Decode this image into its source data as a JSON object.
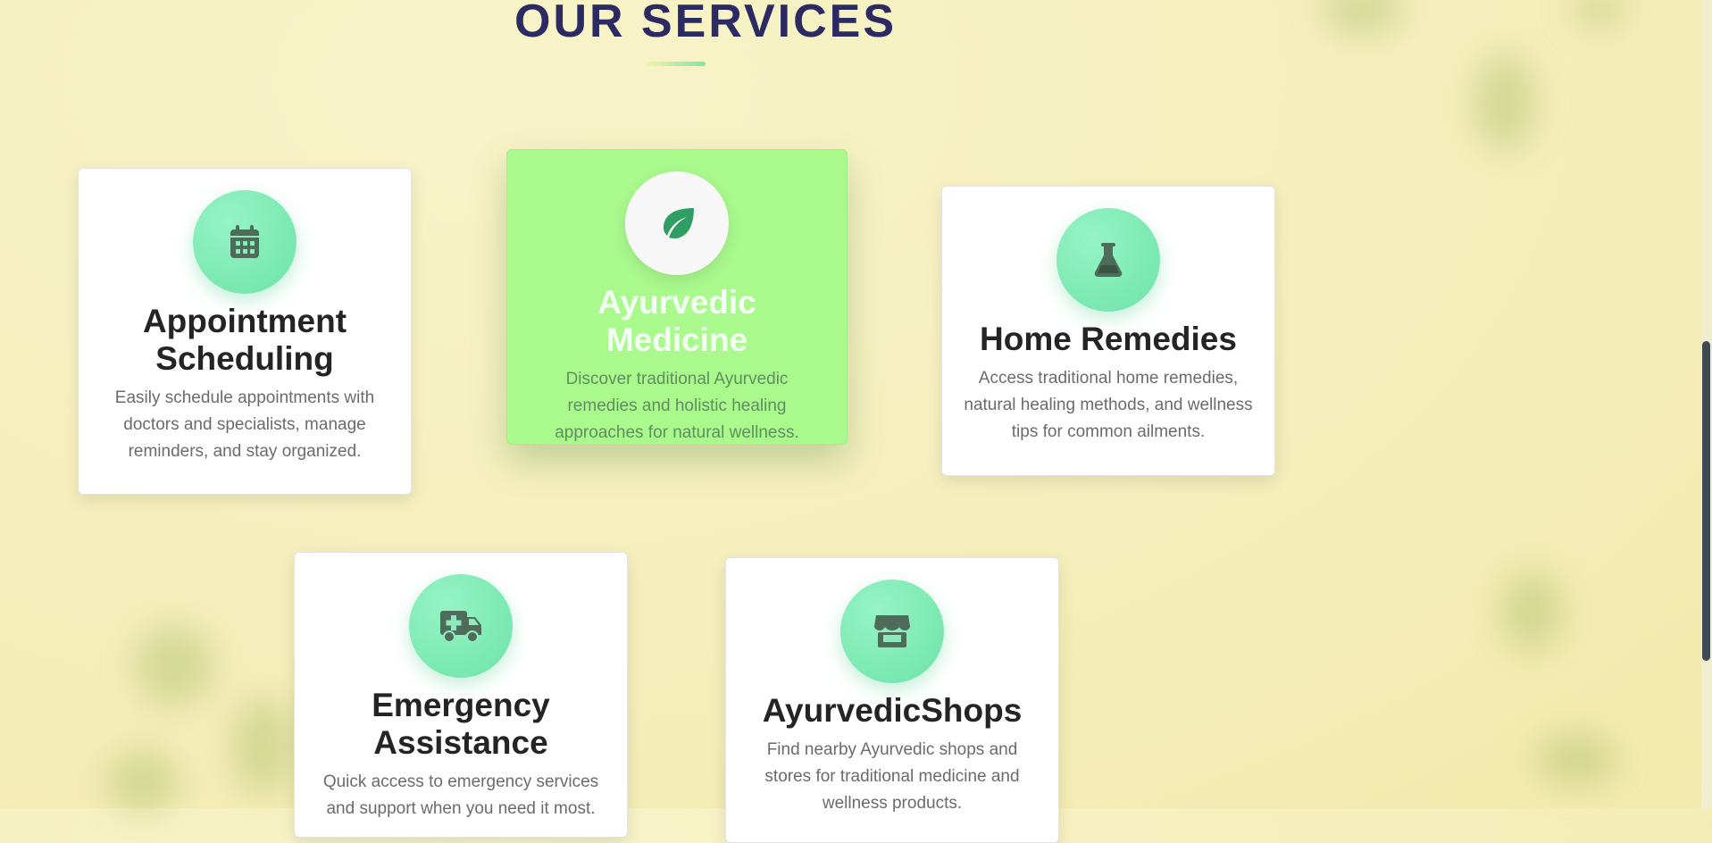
{
  "section": {
    "title": "OUR SERVICES"
  },
  "services": [
    {
      "title": "Appointment Scheduling",
      "description": "Easily schedule appointments with doctors and specialists, manage reminders, and stay organized.",
      "icon": "calendar-icon"
    },
    {
      "title": "Ayurvedic Medicine",
      "description": "Discover traditional Ayurvedic remedies and holistic healing approaches for natural wellness.",
      "icon": "leaf-icon"
    },
    {
      "title": "Home Remedies",
      "description": "Access traditional home remedies, natural healing methods, and wellness tips for common ailments.",
      "icon": "flask-icon"
    },
    {
      "title": "Emergency Assistance",
      "description": "Quick access to emergency services and support when you need it most.",
      "icon": "ambulance-icon"
    },
    {
      "title": "AyurvedicShops",
      "description": "Find nearby Ayurvedic shops and stores for traditional medicine and wellness products.",
      "icon": "store-icon"
    }
  ],
  "colors": {
    "accent": "#6fe3a8",
    "featured_card": "#a9f98d",
    "title": "#2b2a62",
    "icon_glyph": "#4f6b5c",
    "leaf_glyph": "#2e9e63"
  }
}
